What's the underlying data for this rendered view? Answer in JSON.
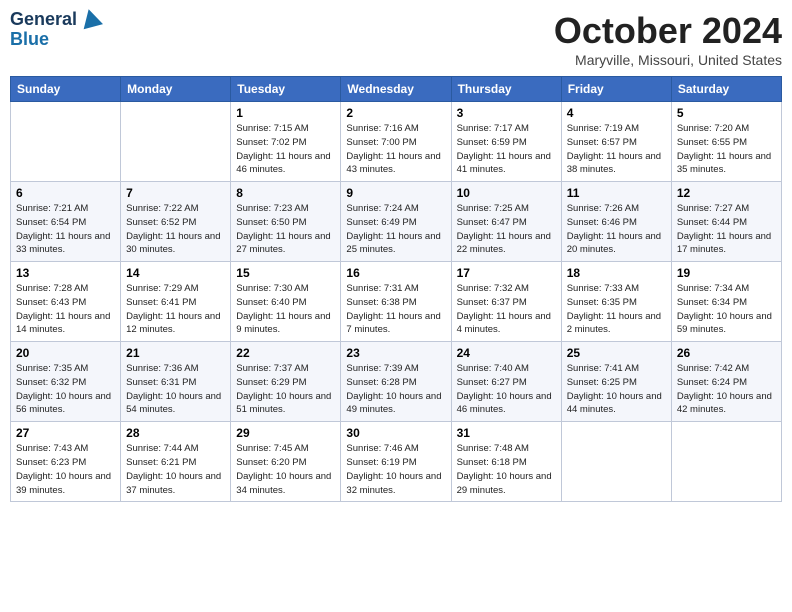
{
  "header": {
    "logo_line1": "General",
    "logo_line2": "Blue",
    "month_title": "October 2024",
    "location": "Maryville, Missouri, United States"
  },
  "weekdays": [
    "Sunday",
    "Monday",
    "Tuesday",
    "Wednesday",
    "Thursday",
    "Friday",
    "Saturday"
  ],
  "weeks": [
    [
      {
        "day": "",
        "info": ""
      },
      {
        "day": "",
        "info": ""
      },
      {
        "day": "1",
        "info": "Sunrise: 7:15 AM\nSunset: 7:02 PM\nDaylight: 11 hours and 46 minutes."
      },
      {
        "day": "2",
        "info": "Sunrise: 7:16 AM\nSunset: 7:00 PM\nDaylight: 11 hours and 43 minutes."
      },
      {
        "day": "3",
        "info": "Sunrise: 7:17 AM\nSunset: 6:59 PM\nDaylight: 11 hours and 41 minutes."
      },
      {
        "day": "4",
        "info": "Sunrise: 7:19 AM\nSunset: 6:57 PM\nDaylight: 11 hours and 38 minutes."
      },
      {
        "day": "5",
        "info": "Sunrise: 7:20 AM\nSunset: 6:55 PM\nDaylight: 11 hours and 35 minutes."
      }
    ],
    [
      {
        "day": "6",
        "info": "Sunrise: 7:21 AM\nSunset: 6:54 PM\nDaylight: 11 hours and 33 minutes."
      },
      {
        "day": "7",
        "info": "Sunrise: 7:22 AM\nSunset: 6:52 PM\nDaylight: 11 hours and 30 minutes."
      },
      {
        "day": "8",
        "info": "Sunrise: 7:23 AM\nSunset: 6:50 PM\nDaylight: 11 hours and 27 minutes."
      },
      {
        "day": "9",
        "info": "Sunrise: 7:24 AM\nSunset: 6:49 PM\nDaylight: 11 hours and 25 minutes."
      },
      {
        "day": "10",
        "info": "Sunrise: 7:25 AM\nSunset: 6:47 PM\nDaylight: 11 hours and 22 minutes."
      },
      {
        "day": "11",
        "info": "Sunrise: 7:26 AM\nSunset: 6:46 PM\nDaylight: 11 hours and 20 minutes."
      },
      {
        "day": "12",
        "info": "Sunrise: 7:27 AM\nSunset: 6:44 PM\nDaylight: 11 hours and 17 minutes."
      }
    ],
    [
      {
        "day": "13",
        "info": "Sunrise: 7:28 AM\nSunset: 6:43 PM\nDaylight: 11 hours and 14 minutes."
      },
      {
        "day": "14",
        "info": "Sunrise: 7:29 AM\nSunset: 6:41 PM\nDaylight: 11 hours and 12 minutes."
      },
      {
        "day": "15",
        "info": "Sunrise: 7:30 AM\nSunset: 6:40 PM\nDaylight: 11 hours and 9 minutes."
      },
      {
        "day": "16",
        "info": "Sunrise: 7:31 AM\nSunset: 6:38 PM\nDaylight: 11 hours and 7 minutes."
      },
      {
        "day": "17",
        "info": "Sunrise: 7:32 AM\nSunset: 6:37 PM\nDaylight: 11 hours and 4 minutes."
      },
      {
        "day": "18",
        "info": "Sunrise: 7:33 AM\nSunset: 6:35 PM\nDaylight: 11 hours and 2 minutes."
      },
      {
        "day": "19",
        "info": "Sunrise: 7:34 AM\nSunset: 6:34 PM\nDaylight: 10 hours and 59 minutes."
      }
    ],
    [
      {
        "day": "20",
        "info": "Sunrise: 7:35 AM\nSunset: 6:32 PM\nDaylight: 10 hours and 56 minutes."
      },
      {
        "day": "21",
        "info": "Sunrise: 7:36 AM\nSunset: 6:31 PM\nDaylight: 10 hours and 54 minutes."
      },
      {
        "day": "22",
        "info": "Sunrise: 7:37 AM\nSunset: 6:29 PM\nDaylight: 10 hours and 51 minutes."
      },
      {
        "day": "23",
        "info": "Sunrise: 7:39 AM\nSunset: 6:28 PM\nDaylight: 10 hours and 49 minutes."
      },
      {
        "day": "24",
        "info": "Sunrise: 7:40 AM\nSunset: 6:27 PM\nDaylight: 10 hours and 46 minutes."
      },
      {
        "day": "25",
        "info": "Sunrise: 7:41 AM\nSunset: 6:25 PM\nDaylight: 10 hours and 44 minutes."
      },
      {
        "day": "26",
        "info": "Sunrise: 7:42 AM\nSunset: 6:24 PM\nDaylight: 10 hours and 42 minutes."
      }
    ],
    [
      {
        "day": "27",
        "info": "Sunrise: 7:43 AM\nSunset: 6:23 PM\nDaylight: 10 hours and 39 minutes."
      },
      {
        "day": "28",
        "info": "Sunrise: 7:44 AM\nSunset: 6:21 PM\nDaylight: 10 hours and 37 minutes."
      },
      {
        "day": "29",
        "info": "Sunrise: 7:45 AM\nSunset: 6:20 PM\nDaylight: 10 hours and 34 minutes."
      },
      {
        "day": "30",
        "info": "Sunrise: 7:46 AM\nSunset: 6:19 PM\nDaylight: 10 hours and 32 minutes."
      },
      {
        "day": "31",
        "info": "Sunrise: 7:48 AM\nSunset: 6:18 PM\nDaylight: 10 hours and 29 minutes."
      },
      {
        "day": "",
        "info": ""
      },
      {
        "day": "",
        "info": ""
      }
    ]
  ]
}
